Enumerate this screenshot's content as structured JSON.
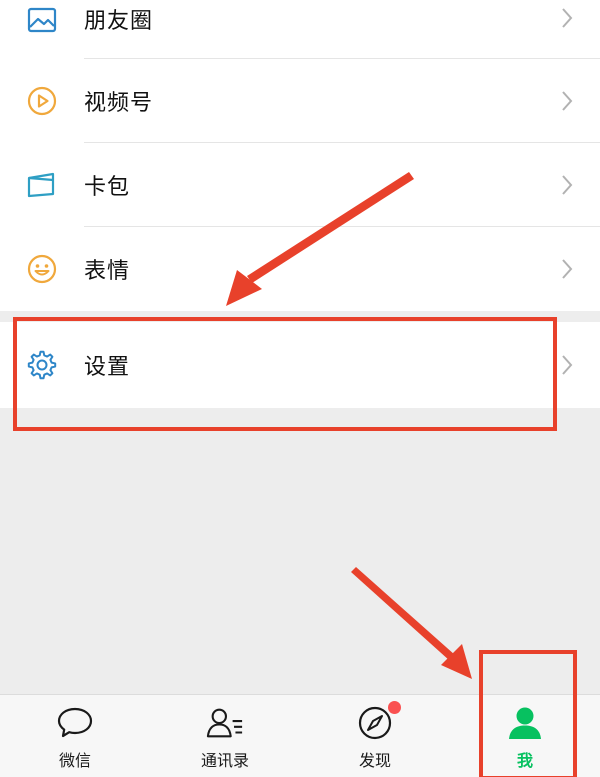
{
  "menu": {
    "items": [
      {
        "label": "朋友圈",
        "icon": "moments-photo-icon"
      },
      {
        "label": "视频号",
        "icon": "channels-play-icon"
      },
      {
        "label": "卡包",
        "icon": "card-wallet-icon"
      },
      {
        "label": "表情",
        "icon": "sticker-smile-icon"
      }
    ],
    "settings": {
      "label": "设置",
      "icon": "gear-icon"
    }
  },
  "tab_bar": {
    "tabs": [
      {
        "label": "微信",
        "icon": "chat-bubble-icon",
        "active": false
      },
      {
        "label": "通讯录",
        "icon": "contacts-icon",
        "active": false
      },
      {
        "label": "发现",
        "icon": "compass-icon",
        "active": false,
        "badge": true
      },
      {
        "label": "我",
        "icon": "person-icon",
        "active": true
      }
    ]
  },
  "colors": {
    "accent_green": "#07C160",
    "annotation_red": "#E8412B",
    "badge_red": "#FA5151",
    "icon_blue": "#2E86C8",
    "icon_orange": "#F0A83C",
    "background": "#EDEDED"
  }
}
